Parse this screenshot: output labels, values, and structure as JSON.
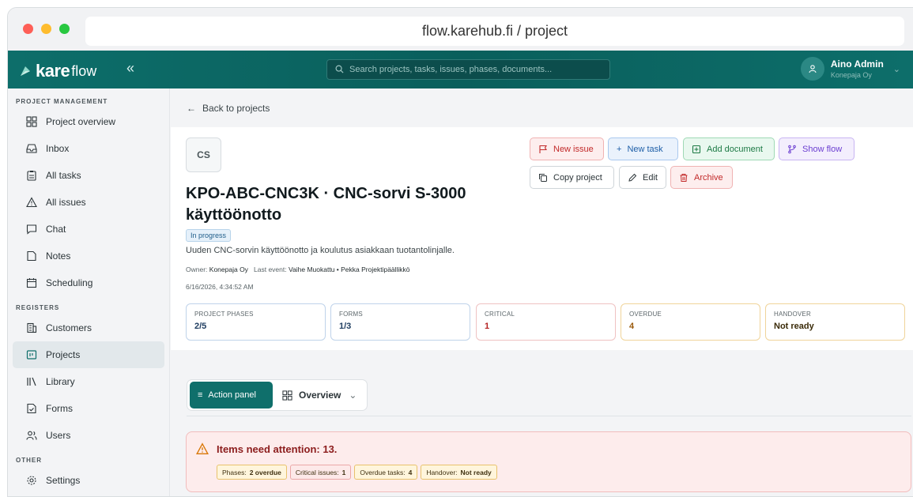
{
  "browser": {
    "url": "flow.karehub.fi / project"
  },
  "topnav": {
    "logo_main": "kare",
    "logo_sub": "flow",
    "collapse_glyph": "«",
    "search_placeholder": "Search projects, tasks, issues, phases, documents...",
    "user_name": "Aino Admin",
    "user_org": "Konepaja Oy"
  },
  "sidebar": {
    "sections": [
      {
        "title": "PROJECT MANAGEMENT"
      },
      {
        "title": "REGISTERS"
      },
      {
        "title": "OTHER"
      }
    ],
    "items": [
      {
        "label": "Project overview",
        "icon": "grid-icon"
      },
      {
        "label": "Inbox",
        "icon": "inbox-icon"
      },
      {
        "label": "All tasks",
        "icon": "clipboard-icon"
      },
      {
        "label": "All issues",
        "icon": "warning-icon"
      },
      {
        "label": "Chat",
        "icon": "chat-icon"
      },
      {
        "label": "Notes",
        "icon": "note-icon"
      },
      {
        "label": "Scheduling",
        "icon": "calendar-icon"
      },
      {
        "label": "Customers",
        "icon": "building-icon"
      },
      {
        "label": "Projects",
        "icon": "project-icon",
        "active": true
      },
      {
        "label": "Library",
        "icon": "library-icon"
      },
      {
        "label": "Forms",
        "icon": "form-icon"
      },
      {
        "label": "Users",
        "icon": "users-icon"
      },
      {
        "label": "Settings",
        "icon": "gear-icon"
      }
    ]
  },
  "main": {
    "back_label": "Back to projects",
    "initials": "CS",
    "title": "KPO-ABC-CNC3K · CNC-sorvi S-3000 käyttöönotto",
    "status": "In progress",
    "description": "Uuden CNC-sorvin käyttöönotto ja koulutus asiakkaan tuotantolinjalle.",
    "owner_label": "Owner:",
    "owner": "Konepaja Oy",
    "last_event_label": "Last event:",
    "last_event": "Vaihe Muokattu • Pekka Projektipäällikkö",
    "date": "6/16/2026, 4:34:52 AM",
    "actions": {
      "new_issue": "New issue",
      "new_task": "New task",
      "add_document": "Add document",
      "show_flow": "Show flow",
      "copy_project": "Copy project",
      "edit": "Edit",
      "archive": "Archive"
    },
    "stats": [
      {
        "label": "PROJECT PHASES",
        "value": "2/5"
      },
      {
        "label": "FORMS",
        "value": "1/3"
      },
      {
        "label": "CRITICAL",
        "value": "1"
      },
      {
        "label": "OVERDUE",
        "value": "4"
      },
      {
        "label": "HANDOVER",
        "value": "Not ready"
      }
    ],
    "tabs": {
      "action_panel": "Action panel",
      "overview": "Overview"
    },
    "alert": {
      "title": "Items need attention: 13.",
      "chips": [
        {
          "label": "Phases:",
          "value": "2 overdue"
        },
        {
          "label": "Critical issues:",
          "value": "1"
        },
        {
          "label": "Overdue tasks:",
          "value": "4"
        },
        {
          "label": "Handover:",
          "value": "Not ready"
        }
      ]
    }
  },
  "colors": {
    "brand": "#0f6f6b",
    "danger": "#c22a2a",
    "warning": "#9a5a0c"
  }
}
